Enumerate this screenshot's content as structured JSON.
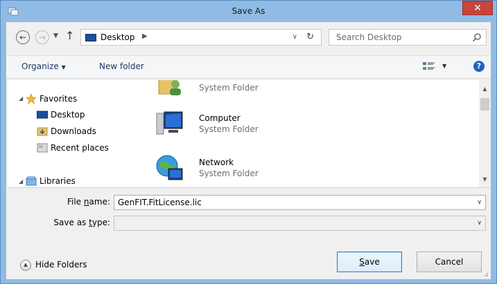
{
  "window": {
    "title": "Save As",
    "close_label": "✕"
  },
  "nav": {
    "back_icon": "back-arrow-icon",
    "forward_icon": "forward-arrow-icon",
    "address_location": "Desktop",
    "search_placeholder": "Search Desktop"
  },
  "toolbar": {
    "organize_label": "Organize",
    "new_folder_label": "New folder",
    "help_label": "?"
  },
  "nav_pane": {
    "items": [
      {
        "label": "Favorites",
        "icon": "star-icon"
      },
      {
        "label": "Desktop",
        "icon": "desktop-icon"
      },
      {
        "label": "Downloads",
        "icon": "downloads-folder-icon"
      },
      {
        "label": "Recent places",
        "icon": "recent-places-icon"
      },
      {
        "label": "Libraries",
        "icon": "libraries-icon"
      }
    ]
  },
  "files": [
    {
      "name": "",
      "type": "System Folder",
      "icon": "user-folder-icon"
    },
    {
      "name": "Computer",
      "type": "System Folder",
      "icon": "computer-icon"
    },
    {
      "name": "Network",
      "type": "System Folder",
      "icon": "network-icon"
    }
  ],
  "form": {
    "file_name_label_pre": "File ",
    "file_name_label_u": "n",
    "file_name_label_post": "ame:",
    "file_name_value": "GenFIT.FitLicense.lic",
    "save_type_label_pre": "Save as ",
    "save_type_label_u": "t",
    "save_type_label_post": "ype:",
    "save_type_value": ""
  },
  "footer": {
    "hide_folders_label": "Hide Folders",
    "save_label_u": "S",
    "save_label_post": "ave",
    "cancel_label": "Cancel"
  }
}
